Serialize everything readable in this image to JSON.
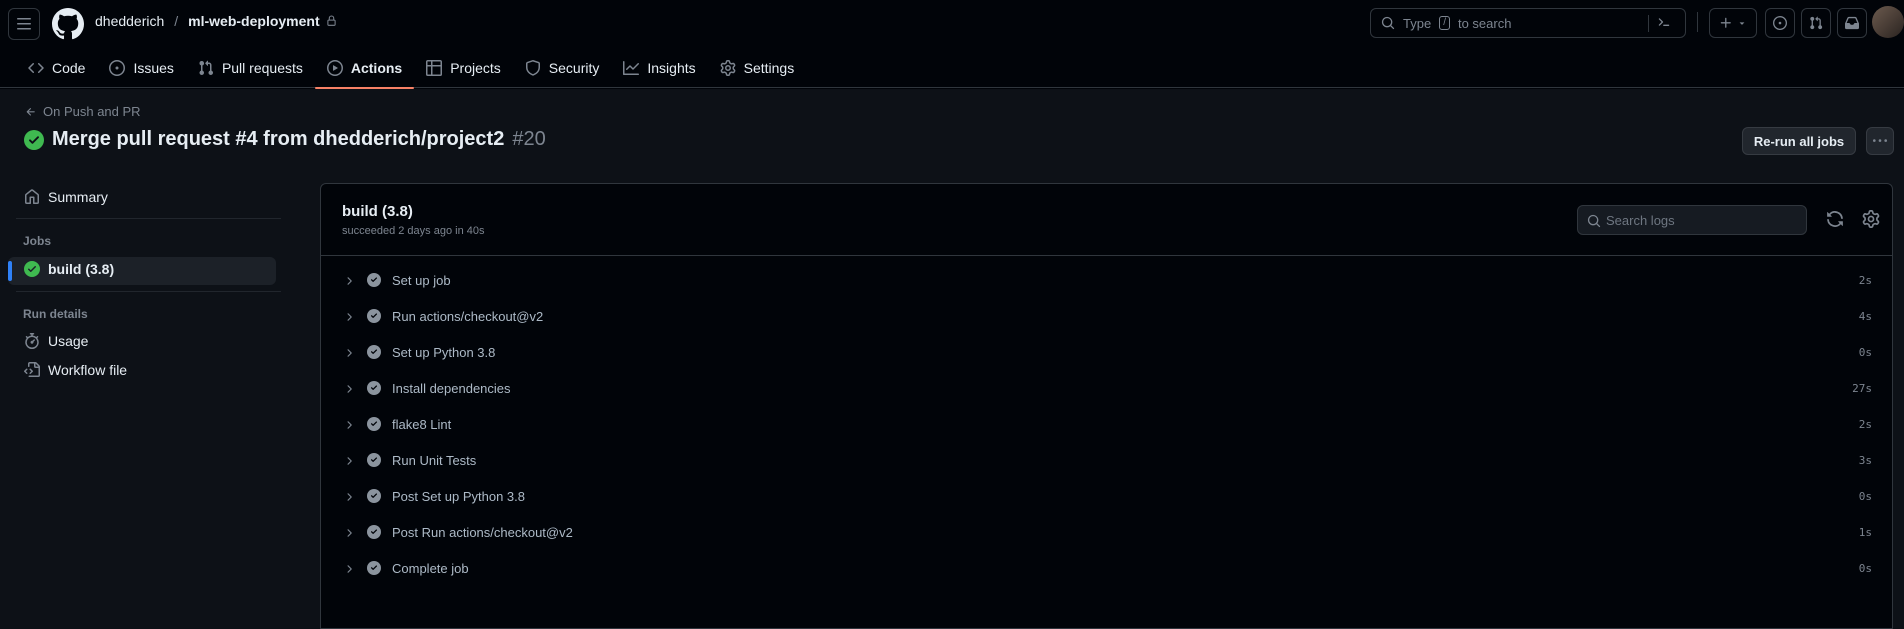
{
  "header": {
    "owner": "dhedderich",
    "separator": "/",
    "repo": "ml-web-deployment",
    "search_type": "Type",
    "search_key": "/",
    "search_rest": "to search"
  },
  "nav": [
    {
      "label": "Code",
      "icon": "code-icon"
    },
    {
      "label": "Issues",
      "icon": "issue-icon"
    },
    {
      "label": "Pull requests",
      "icon": "pull-request-icon"
    },
    {
      "label": "Actions",
      "icon": "play-icon",
      "active": true
    },
    {
      "label": "Projects",
      "icon": "table-icon"
    },
    {
      "label": "Security",
      "icon": "shield-icon"
    },
    {
      "label": "Insights",
      "icon": "graph-icon"
    },
    {
      "label": "Settings",
      "icon": "gear-icon"
    }
  ],
  "run": {
    "back_label": "On Push and PR",
    "title": "Merge pull request #4 from dhedderich/project2",
    "number": "#20",
    "rerun_label": "Re-run all jobs"
  },
  "sidebar": {
    "summary": "Summary",
    "jobs_heading": "Jobs",
    "job_item": "build (3.8)",
    "run_details_heading": "Run details",
    "usage": "Usage",
    "workflow_file": "Workflow file"
  },
  "job": {
    "title": "build (3.8)",
    "subtitle": "succeeded 2 days ago in 40s",
    "search_placeholder": "Search logs",
    "steps": [
      {
        "label": "Set up job",
        "duration": "2s"
      },
      {
        "label": "Run actions/checkout@v2",
        "duration": "4s"
      },
      {
        "label": "Set up Python 3.8",
        "duration": "0s"
      },
      {
        "label": "Install dependencies",
        "duration": "27s"
      },
      {
        "label": "flake8 Lint",
        "duration": "2s"
      },
      {
        "label": "Run Unit Tests",
        "duration": "3s"
      },
      {
        "label": "Post Set up Python 3.8",
        "duration": "0s"
      },
      {
        "label": "Post Run actions/checkout@v2",
        "duration": "1s"
      },
      {
        "label": "Complete job",
        "duration": "0s"
      }
    ]
  },
  "colors": {
    "success": "#3fb950",
    "accent_underline": "#f78166",
    "active_marker": "#2f81f7"
  }
}
